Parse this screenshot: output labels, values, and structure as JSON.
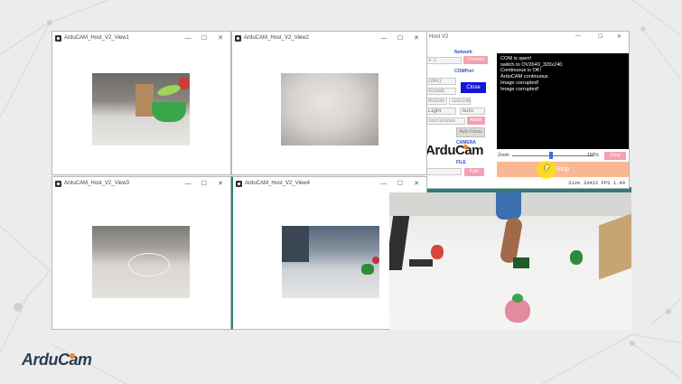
{
  "windows": [
    {
      "title": "ArduCAM_Host_V2_View1"
    },
    {
      "title": "ArduCAM_Host_V2_View2"
    },
    {
      "title": "ArduCAM_Host_V2_View3"
    },
    {
      "title": "ArduCAM_Host_V2_View4"
    }
  ],
  "host": {
    "title": "Host V2",
    "network_label": "Network",
    "ip_value": "4.1",
    "connect_label": "Connect",
    "comport_label": "COMPort",
    "com_value": "COM11",
    "baud_value": "921600",
    "sensor_value": "OV2640",
    "resolution_value": "320x240",
    "light_value": "Light",
    "auto_value": "Auto",
    "mode_value": "Continuous",
    "close_label": "Close",
    "adapt_label": "Adapt",
    "auto_focus_label": "Auto Focus",
    "camera_label": "CAMERA",
    "file_label": "FILE",
    "path_label": "Path",
    "logo_text": "ArduCam",
    "terminal_lines": [
      "COM is open!",
      "switch to OV2640_320x240",
      "",
      "Continuous is OK!",
      "",
      "ArduCAM continuous",
      "Image corrupted!",
      "Image corrupted!"
    ],
    "zoom_left": "Zoom",
    "zoom_percent": "100%",
    "clear_label": "Clear",
    "stop_label": "Stop",
    "status_text": "Size 33422 FPS 1.40"
  },
  "brand": {
    "logo_text": "ArduCam",
    "accent": "#f5832a",
    "dark": "#2a3d52"
  },
  "colors": {
    "teal": "#2e7d7a",
    "pink": "#f3a0b0",
    "button_peach": "#f9b893"
  }
}
